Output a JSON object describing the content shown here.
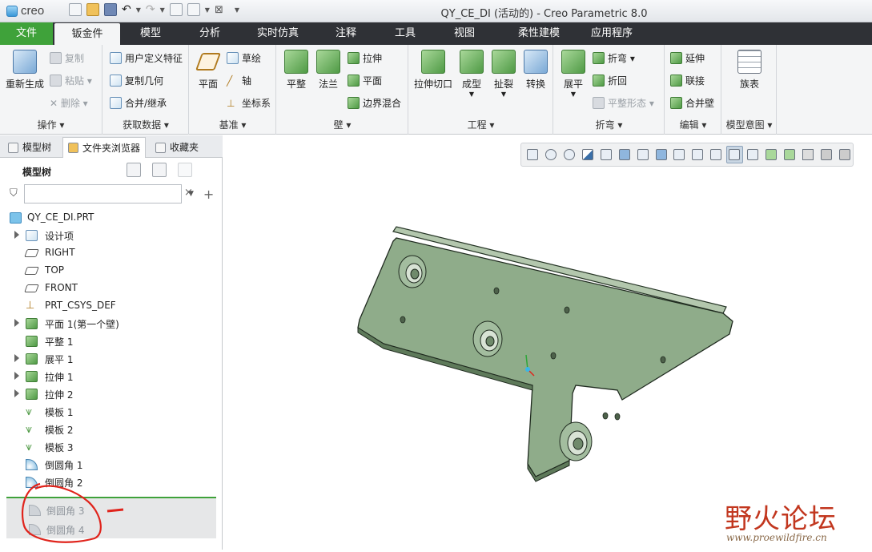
{
  "app": {
    "logo_text": "creo",
    "window_title": "QY_CE_DI (活动的) - Creo Parametric 8.0"
  },
  "menu": {
    "tabs": [
      {
        "label": "文件"
      },
      {
        "label": "钣金件"
      },
      {
        "label": "模型"
      },
      {
        "label": "分析"
      },
      {
        "label": "实时仿真"
      },
      {
        "label": "注释"
      },
      {
        "label": "工具"
      },
      {
        "label": "视图"
      },
      {
        "label": "柔性建模"
      },
      {
        "label": "应用程序"
      }
    ]
  },
  "ribbon": {
    "groups": {
      "operations": {
        "label": "操作 ▾",
        "regenerate": "重新生成",
        "copy": "复制",
        "paste": "粘贴 ▾",
        "delete": "✕ 删除 ▾"
      },
      "get_data": {
        "label": "获取数据 ▾",
        "udf": "用户定义特征",
        "copy_geom": "复制几何",
        "merge": "合并/继承"
      },
      "datum": {
        "label": "基准 ▾",
        "plane": "平面",
        "sketch": "草绘",
        "axis": "轴",
        "csys": "坐标系"
      },
      "wall": {
        "label": "壁 ▾",
        "flat": "平整",
        "flange": "法兰",
        "extrude": "拉伸",
        "planar": "平面",
        "blend": "边界混合"
      },
      "engineering": {
        "label": "工程 ▾",
        "extrude_cut": "拉伸切口",
        "form": "成型",
        "rip": "扯裂",
        "convert": "转换"
      },
      "bend": {
        "label": "折弯 ▾",
        "unbend": "展平",
        "bend": "折弯 ▾",
        "bend_back": "折回",
        "flat_state": "平整形态 ▾"
      },
      "edit": {
        "label": "编辑 ▾",
        "extend": "延伸",
        "join": "联接",
        "merge_walls": "合并壁"
      },
      "intent": {
        "label": "模型意图 ▾",
        "family_table": "族表"
      }
    }
  },
  "nav_tabs": [
    {
      "label": "模型树"
    },
    {
      "label": "文件夹浏览器"
    },
    {
      "label": "收藏夹"
    }
  ],
  "tree": {
    "header": "模型树",
    "search": {
      "value": "",
      "placeholder": ""
    },
    "items": [
      {
        "label": "QY_CE_DI.PRT"
      },
      {
        "label": "设计项"
      },
      {
        "label": "RIGHT"
      },
      {
        "label": "TOP"
      },
      {
        "label": "FRONT"
      },
      {
        "label": "PRT_CSYS_DEF"
      },
      {
        "label": "平面 1(第一个壁)"
      },
      {
        "label": "平整 1"
      },
      {
        "label": "展平 1"
      },
      {
        "label": "拉伸 1"
      },
      {
        "label": "拉伸 2"
      },
      {
        "label": "模板 1"
      },
      {
        "label": "模板 2"
      },
      {
        "label": "模板 3"
      },
      {
        "label": "倒圆角 1"
      },
      {
        "label": "倒圆角 2"
      },
      {
        "label": "倒圆角 3"
      },
      {
        "label": "倒圆角 4"
      }
    ]
  },
  "watermark": {
    "cn": "野火论坛",
    "url": "www.proewildfire.cn"
  },
  "colors": {
    "file_tab": "#3fa23a",
    "menubar": "#2f3136",
    "part_fill": "#8fac8a",
    "annotation": "#e0241c"
  }
}
